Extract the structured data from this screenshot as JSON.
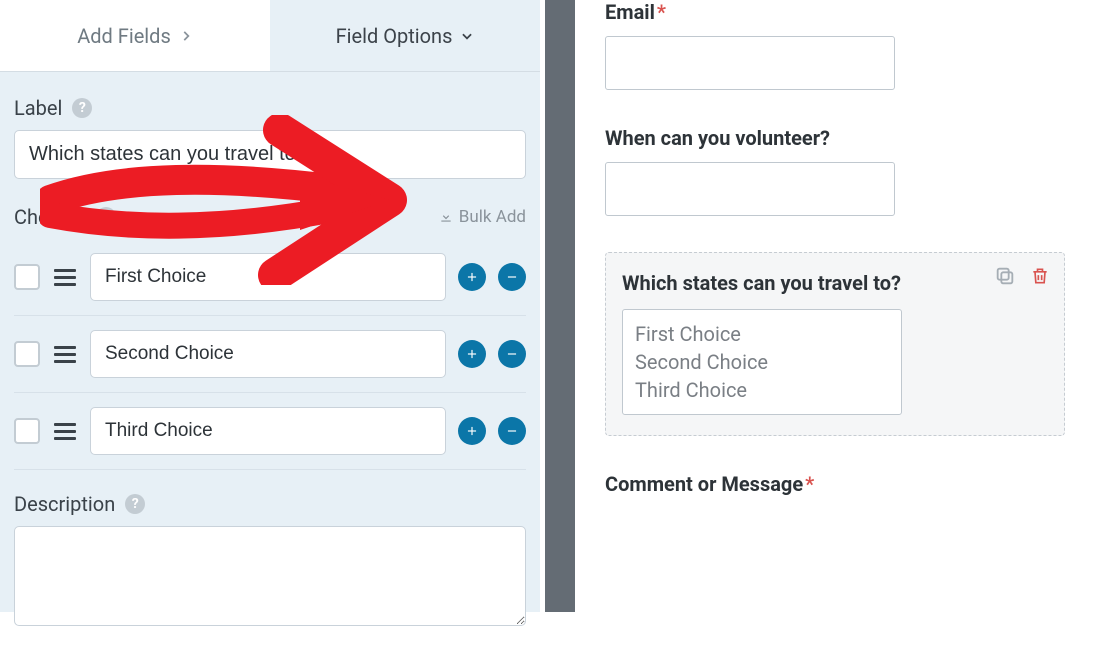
{
  "tabs": {
    "add_fields": "Add Fields",
    "field_options": "Field Options"
  },
  "sections": {
    "label": "Label",
    "choices": "Choices",
    "description": "Description",
    "bulk_add": "Bulk Add"
  },
  "label_value": "Which states can you travel to?",
  "choices": [
    {
      "label": "First Choice"
    },
    {
      "label": "Second Choice"
    },
    {
      "label": "Third Choice"
    }
  ],
  "description_value": "",
  "preview": {
    "email": {
      "label": "Email",
      "required": true,
      "value": ""
    },
    "volunteer": {
      "label": "When can you volunteer?",
      "required": false,
      "value": ""
    },
    "states": {
      "label": "Which states can you travel to?",
      "options": [
        "First Choice",
        "Second Choice",
        "Third Choice"
      ]
    },
    "comment": {
      "label": "Comment or Message",
      "required": true
    }
  }
}
